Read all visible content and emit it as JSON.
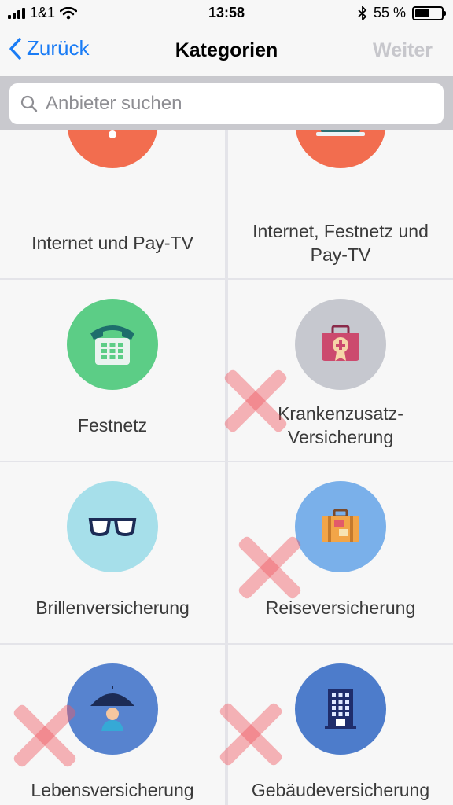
{
  "status": {
    "carrier": "1&1",
    "time": "13:58",
    "battery_text": "55 %",
    "battery_level": 0.55
  },
  "nav": {
    "back_label": "Zurück",
    "title": "Kategorien",
    "next_label": "Weiter"
  },
  "search": {
    "placeholder": "Anbieter suchen"
  },
  "categories": [
    {
      "label": "Internet und Pay-TV",
      "color": "#f26d4f",
      "icon": "wifi-icon"
    },
    {
      "label": "Internet, Festnetz und Pay-TV",
      "color": "#f26d4f",
      "icon": "laptop-phone-icon"
    },
    {
      "label": "Festnetz",
      "color": "#5ccd86",
      "icon": "telephone-icon"
    },
    {
      "label": "Krankenzusatz-Versicherung",
      "color": "#c6c8cf",
      "icon": "medical-kit-icon"
    },
    {
      "label": "Brillenversicherung",
      "color": "#a6dfea",
      "icon": "glasses-icon"
    },
    {
      "label": "Reiseversicherung",
      "color": "#7ab0ea",
      "icon": "suitcase-icon"
    },
    {
      "label": "Lebensversicherung",
      "color": "#5783cf",
      "icon": "umbrella-person-icon"
    },
    {
      "label": "Gebäudeversicherung",
      "color": "#4d7ccb",
      "icon": "building-icon"
    }
  ],
  "colors": {
    "accent": "#1a7cf5",
    "mark": "#f05a64"
  }
}
